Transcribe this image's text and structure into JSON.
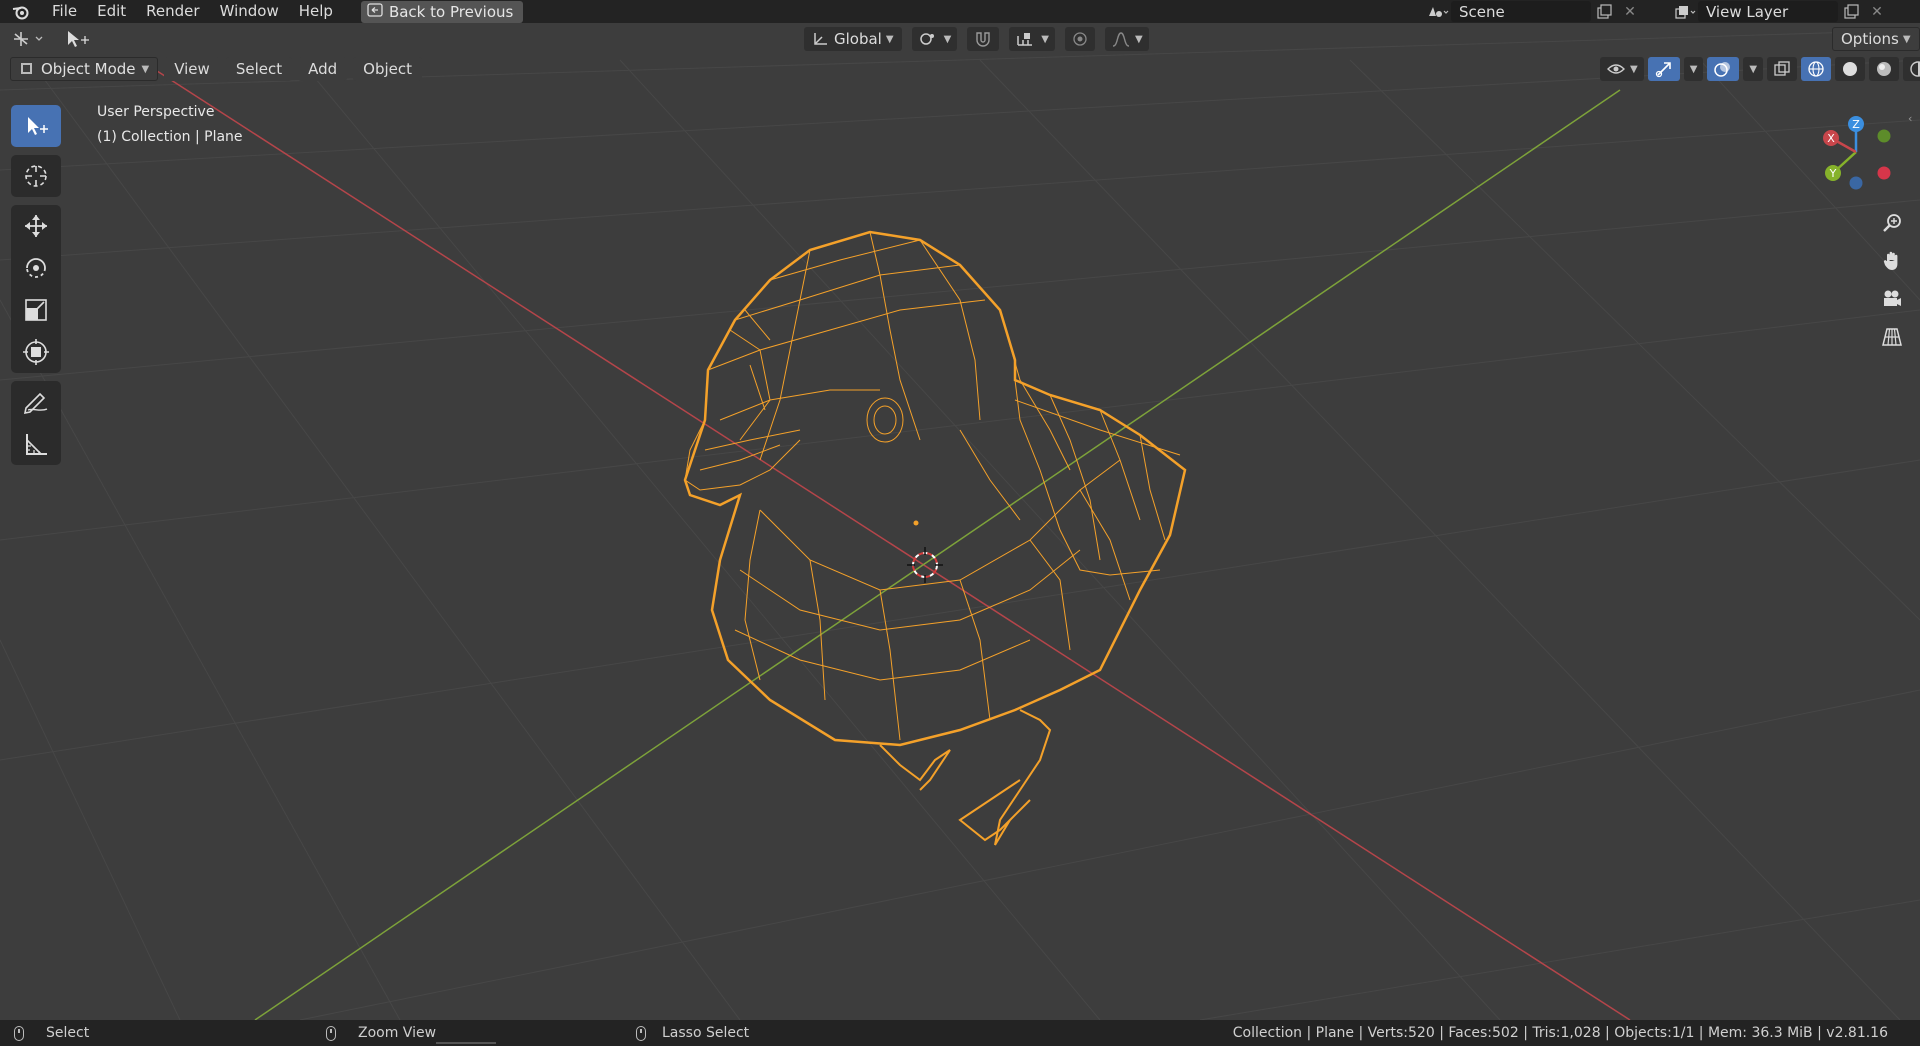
{
  "topbar": {
    "menus": [
      "File",
      "Edit",
      "Render",
      "Window",
      "Help"
    ],
    "back_button": "Back to Previous",
    "scene": "Scene",
    "view_layer": "View Layer"
  },
  "header": {
    "mode": "Object Mode",
    "menus": [
      "View",
      "Select",
      "Add",
      "Object"
    ],
    "orientation": "Global",
    "options": "Options"
  },
  "overlay": {
    "perspective": "User Perspective",
    "collection": "(1) Collection | Plane"
  },
  "gizmo": {
    "x": "X",
    "y": "Y",
    "z": "Z"
  },
  "statusbar": {
    "left": "Select",
    "middle": "Zoom View",
    "right": "Lasso Select",
    "stats": "Collection | Plane | Verts:520 | Faces:502 | Tris:1,028 | Objects:1/1 | Mem: 36.3 MiB | v2.81.16"
  },
  "colors": {
    "accent": "#4772b3",
    "selection": "#f4a12a",
    "x_axis": "#c8464b",
    "y_axis": "#86b22b",
    "z_axis": "#3b8fe0"
  }
}
